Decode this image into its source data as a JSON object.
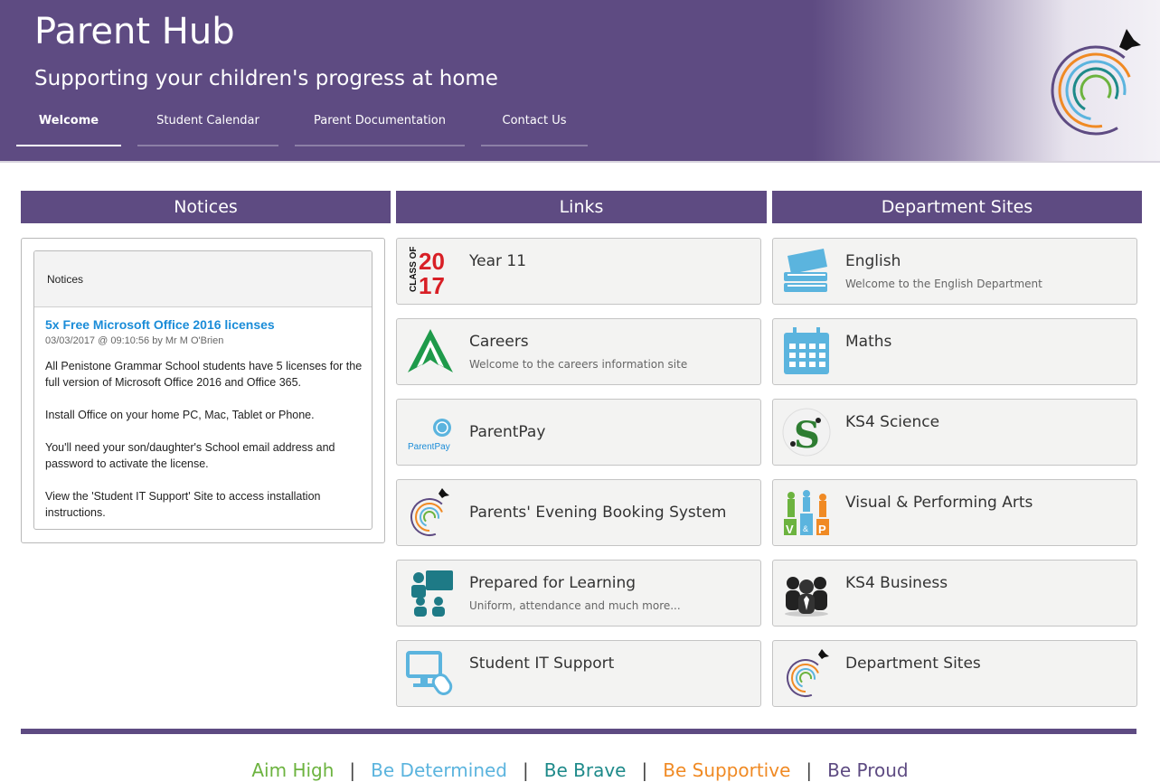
{
  "header": {
    "title": "Parent Hub",
    "subtitle": "Supporting your children's progress at home",
    "nav": [
      {
        "label": "Welcome",
        "active": true
      },
      {
        "label": "Student Calendar",
        "active": false
      },
      {
        "label": "Parent Documentation",
        "active": false
      },
      {
        "label": "Contact Us",
        "active": false
      }
    ]
  },
  "sections": {
    "notices": "Notices",
    "links": "Links",
    "departments": "Department Sites"
  },
  "notices": {
    "bar_label": "Notices",
    "title": "5x Free Microsoft Office 2016 licenses",
    "meta": "03/03/2017 @ 09:10:56 by Mr M O'Brien",
    "paragraphs": [
      "All Penistone Grammar School students have 5 licenses for the full version of Microsoft Office 2016 and Office 365.",
      "Install Office on your home PC, Mac, Tablet or Phone.",
      "You'll need your son/daughter's School email address and password to activate the license.",
      "View the 'Student IT Support' Site to access installation instructions."
    ]
  },
  "links": [
    {
      "title": "Year 11",
      "subtitle": "",
      "icon": "class-of-2017-icon",
      "icon_text": {
        "a": "CLASS OF",
        "b": "20",
        "c": "17"
      }
    },
    {
      "title": "Careers",
      "subtitle": "Welcome to the careers information site",
      "icon": "careers-arrow-icon"
    },
    {
      "title": "ParentPay",
      "subtitle": "",
      "icon": "parentpay-icon",
      "icon_text": "ParentPay"
    },
    {
      "title": "Parents' Evening Booking System",
      "subtitle": "",
      "icon": "school-logo-icon"
    },
    {
      "title": "Prepared for Learning",
      "subtitle": "Uniform, attendance and much more...",
      "icon": "classroom-teacher-icon"
    },
    {
      "title": "Student IT Support",
      "subtitle": "",
      "icon": "computer-mouse-icon"
    }
  ],
  "departments": [
    {
      "title": "English",
      "subtitle": "Welcome to the English Department",
      "icon": "books-icon"
    },
    {
      "title": "Maths",
      "subtitle": "",
      "icon": "calendar-grid-icon"
    },
    {
      "title": "KS4 Science",
      "subtitle": "",
      "icon": "science-s-icon",
      "icon_text": "S"
    },
    {
      "title": "Visual & Performing Arts",
      "subtitle": "",
      "icon": "vpa-icon",
      "icon_text": {
        "v": "V",
        "amp": "&",
        "p": "P"
      }
    },
    {
      "title": "KS4 Business",
      "subtitle": "",
      "icon": "business-people-icon"
    },
    {
      "title": "Department Sites",
      "subtitle": "",
      "icon": "school-logo-icon"
    }
  ],
  "motto": [
    {
      "text": "Aim High",
      "color": "#6cb33f"
    },
    {
      "text": "Be Determined",
      "color": "#5bb4de"
    },
    {
      "text": "Be Brave",
      "color": "#1e8a8a"
    },
    {
      "text": "Be Supportive",
      "color": "#f08a24"
    },
    {
      "text": "Be Proud",
      "color": "#5e4b82"
    }
  ],
  "motto_separator": "|",
  "colors": {
    "brand_purple": "#5e4b82",
    "link_blue": "#1a8cd8"
  }
}
